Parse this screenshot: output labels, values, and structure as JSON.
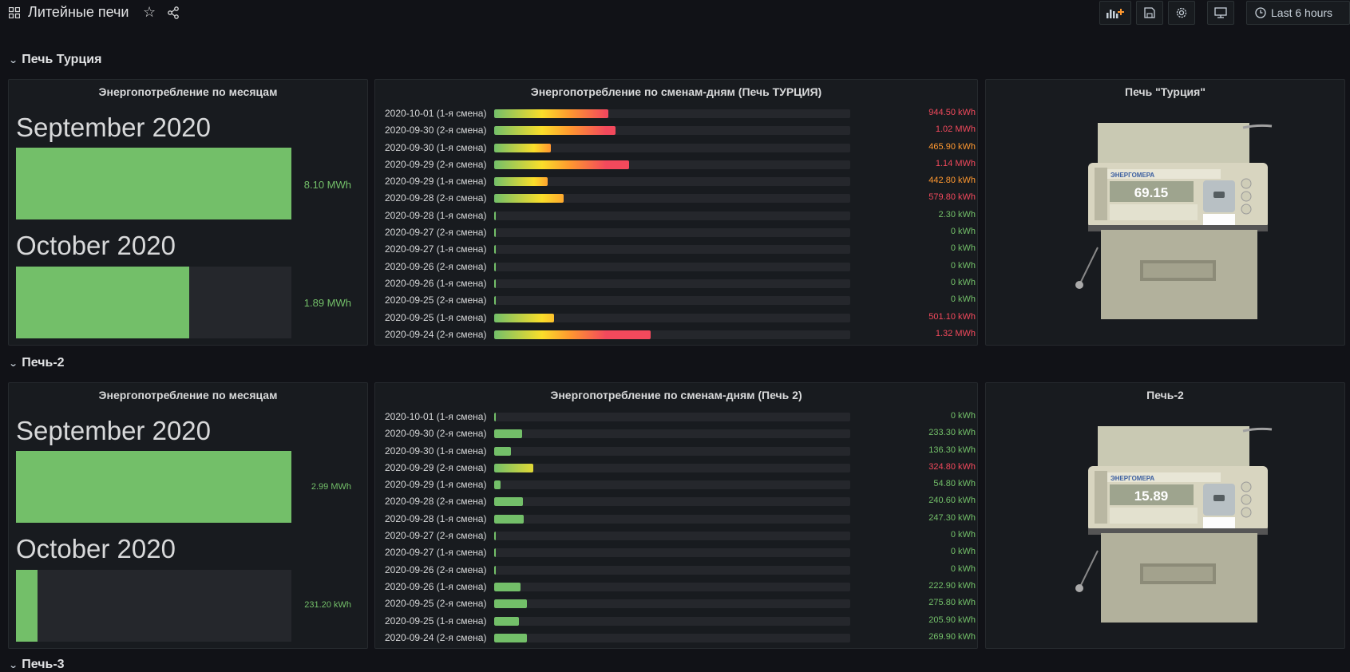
{
  "header": {
    "title": "Литейные печи",
    "timepicker_label": "Last 6 hours"
  },
  "colors": {
    "green": "#73bf69",
    "orange": "#ff9830",
    "red": "#f2495c",
    "yellow": "#fade2a"
  },
  "rows": [
    {
      "title": "Печь Турция",
      "months_panel": {
        "title": "Энергопотребление по месяцам",
        "months": [
          {
            "label": "September 2020",
            "value": "8.10 MWh",
            "fill": 1.0
          },
          {
            "label": "October 2020",
            "value": "1.89 MWh",
            "fill": 0.63
          }
        ]
      },
      "shifts_panel": {
        "title": "Энергопотребление по сменам-дням (Печь ТУРЦИЯ)",
        "items": [
          {
            "label": "2020-10-01 (1-я смена)",
            "value": "944.50 kWh",
            "fill": 0.32,
            "level": "red"
          },
          {
            "label": "2020-09-30 (2-я смена)",
            "value": "1.02 MWh",
            "fill": 0.34,
            "level": "red"
          },
          {
            "label": "2020-09-30 (1-я смена)",
            "value": "465.90 kWh",
            "fill": 0.16,
            "level": "orange"
          },
          {
            "label": "2020-09-29 (2-я смена)",
            "value": "1.14 MWh",
            "fill": 0.38,
            "level": "red"
          },
          {
            "label": "2020-09-29 (1-я смена)",
            "value": "442.80 kWh",
            "fill": 0.15,
            "level": "orange"
          },
          {
            "label": "2020-09-28 (2-я смена)",
            "value": "579.80 kWh",
            "fill": 0.195,
            "level": "red"
          },
          {
            "label": "2020-09-28 (1-я смена)",
            "value": "2.30 kWh",
            "fill": 0.004,
            "level": "green"
          },
          {
            "label": "2020-09-27 (2-я смена)",
            "value": "0 kWh",
            "fill": 0.003,
            "level": "green"
          },
          {
            "label": "2020-09-27 (1-я смена)",
            "value": "0 kWh",
            "fill": 0.003,
            "level": "green"
          },
          {
            "label": "2020-09-26 (2-я смена)",
            "value": "0 kWh",
            "fill": 0.003,
            "level": "green"
          },
          {
            "label": "2020-09-26 (1-я смена)",
            "value": "0 kWh",
            "fill": 0.003,
            "level": "green"
          },
          {
            "label": "2020-09-25 (2-я смена)",
            "value": "0 kWh",
            "fill": 0.003,
            "level": "green"
          },
          {
            "label": "2020-09-25 (1-я смена)",
            "value": "501.10 kWh",
            "fill": 0.168,
            "level": "red"
          },
          {
            "label": "2020-09-24 (2-я смена)",
            "value": "1.32 MWh",
            "fill": 0.44,
            "level": "red"
          }
        ]
      },
      "image_panel": {
        "title": "Печь \"Турция\"",
        "display": "69.15",
        "brand": "ЭНЕРГОМЕРА"
      }
    },
    {
      "title": "Печь-2",
      "months_panel": {
        "title": "Энергопотребление по месяцам",
        "months": [
          {
            "label": "September 2020",
            "value": "2.99 MWh",
            "fill": 1.0
          },
          {
            "label": "October 2020",
            "value": "231.20 kWh",
            "fill": 0.077
          }
        ]
      },
      "shifts_panel": {
        "title": "Энергопотребление по сменам-дням (Печь 2)",
        "items": [
          {
            "label": "2020-10-01 (1-я смена)",
            "value": "0 kWh",
            "fill": 0.003,
            "level": "green"
          },
          {
            "label": "2020-09-30 (2-я смена)",
            "value": "233.30 kWh",
            "fill": 0.078,
            "level": "green"
          },
          {
            "label": "2020-09-30 (1-я смена)",
            "value": "136.30 kWh",
            "fill": 0.046,
            "level": "green"
          },
          {
            "label": "2020-09-29 (2-я смена)",
            "value": "324.80 kWh",
            "fill": 0.109,
            "level": "red"
          },
          {
            "label": "2020-09-29 (1-я смена)",
            "value": "54.80 kWh",
            "fill": 0.019,
            "level": "green"
          },
          {
            "label": "2020-09-28 (2-я смена)",
            "value": "240.60 kWh",
            "fill": 0.081,
            "level": "green"
          },
          {
            "label": "2020-09-28 (1-я смена)",
            "value": "247.30 kWh",
            "fill": 0.083,
            "level": "green"
          },
          {
            "label": "2020-09-27 (2-я смена)",
            "value": "0 kWh",
            "fill": 0.003,
            "level": "green"
          },
          {
            "label": "2020-09-27 (1-я смена)",
            "value": "0 kWh",
            "fill": 0.003,
            "level": "green"
          },
          {
            "label": "2020-09-26 (2-я смена)",
            "value": "0 kWh",
            "fill": 0.003,
            "level": "green"
          },
          {
            "label": "2020-09-26 (1-я смена)",
            "value": "222.90 kWh",
            "fill": 0.075,
            "level": "green"
          },
          {
            "label": "2020-09-25 (2-я смена)",
            "value": "275.80 kWh",
            "fill": 0.093,
            "level": "green"
          },
          {
            "label": "2020-09-25 (1-я смена)",
            "value": "205.90 kWh",
            "fill": 0.069,
            "level": "green"
          },
          {
            "label": "2020-09-24 (2-я смена)",
            "value": "269.90 kWh",
            "fill": 0.091,
            "level": "green"
          }
        ]
      },
      "image_panel": {
        "title": "Печь-2",
        "display": "15.89",
        "brand": "ЭНЕРГОМЕРА"
      }
    }
  ],
  "next_row_title": "Печь-3"
}
